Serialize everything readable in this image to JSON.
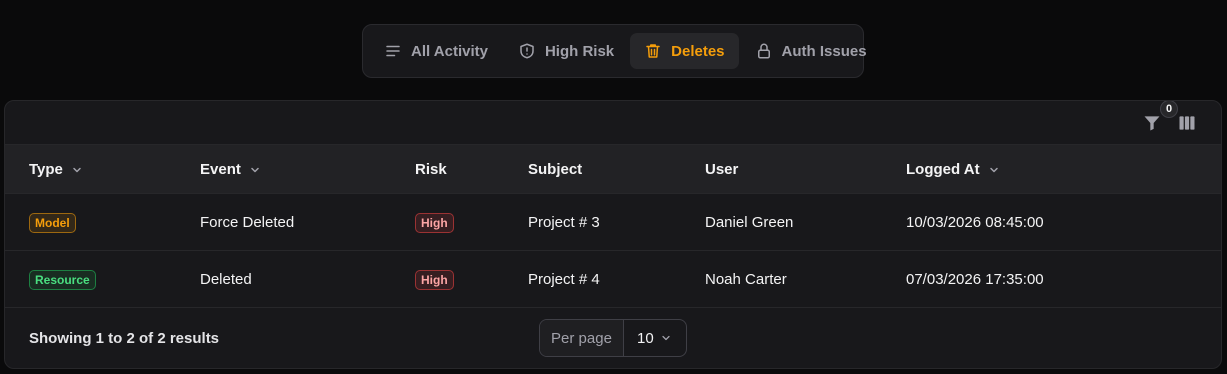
{
  "tabs": [
    {
      "label": "All Activity",
      "icon": "lines-icon",
      "active": false
    },
    {
      "label": "High Risk",
      "icon": "shield-icon",
      "active": false
    },
    {
      "label": "Deletes",
      "icon": "trash-icon",
      "active": true
    },
    {
      "label": "Auth Issues",
      "icon": "lock-icon",
      "active": false
    }
  ],
  "toolbar": {
    "filter_count": "0"
  },
  "columns": {
    "type": "Type",
    "event": "Event",
    "risk": "Risk",
    "subject": "Subject",
    "user": "User",
    "logged_at": "Logged At"
  },
  "rows": [
    {
      "type": "Model",
      "event": "Force Deleted",
      "risk": "High",
      "subject": "Project # 3",
      "user": "Daniel Green",
      "logged_at": "10/03/2026 08:45:00"
    },
    {
      "type": "Resource",
      "event": "Deleted",
      "risk": "High",
      "subject": "Project # 4",
      "user": "Noah Carter",
      "logged_at": "07/03/2026 17:35:00"
    }
  ],
  "footer": {
    "summary": "Showing 1 to 2 of 2 results",
    "per_page_label": "Per page",
    "per_page_value": "10"
  },
  "colors": {
    "accent": "#f59e0b",
    "background": "#0a0a0b",
    "card": "#18181b",
    "model_badge": "#f59e0b",
    "resource_badge": "#22c55e",
    "high_badge": "#ef4444"
  }
}
